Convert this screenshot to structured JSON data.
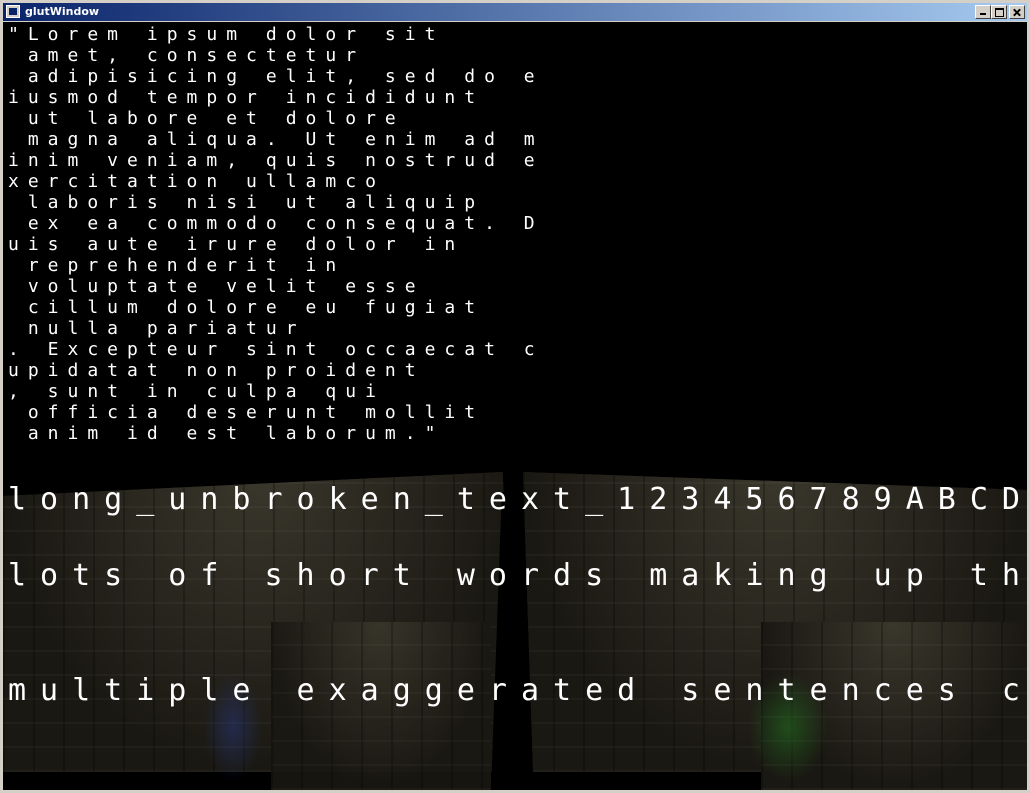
{
  "window": {
    "title": "glutWindow",
    "controls": {
      "minimize": "",
      "maximize": "",
      "close": ""
    }
  },
  "paragraph": {
    "lines": [
      "\"Lorem ipsum dolor sit",
      " amet, consectetur",
      " adipisicing elit, sed do e",
      "iusmod tempor incididunt",
      " ut labore et dolore",
      " magna aliqua. Ut enim ad m",
      "inim veniam, quis nostrud e",
      "xercitation ullamco",
      " laboris nisi ut aliquip",
      " ex ea commodo consequat. D",
      "uis aute irure dolor in",
      " reprehenderit in",
      " voluptate velit esse",
      " cillum dolore eu fugiat",
      " nulla pariatur",
      ". Excepteur sint occaecat c",
      "upidatat non proident",
      ", sunt in culpa qui",
      " officia deserunt mollit",
      " anim id est laborum.\""
    ]
  },
  "large_text": {
    "line1": "long_unbroken_text_123456789ABCD",
    "line2": "lots of short words making up th",
    "line3": "multiple exaggerated sentences c"
  }
}
